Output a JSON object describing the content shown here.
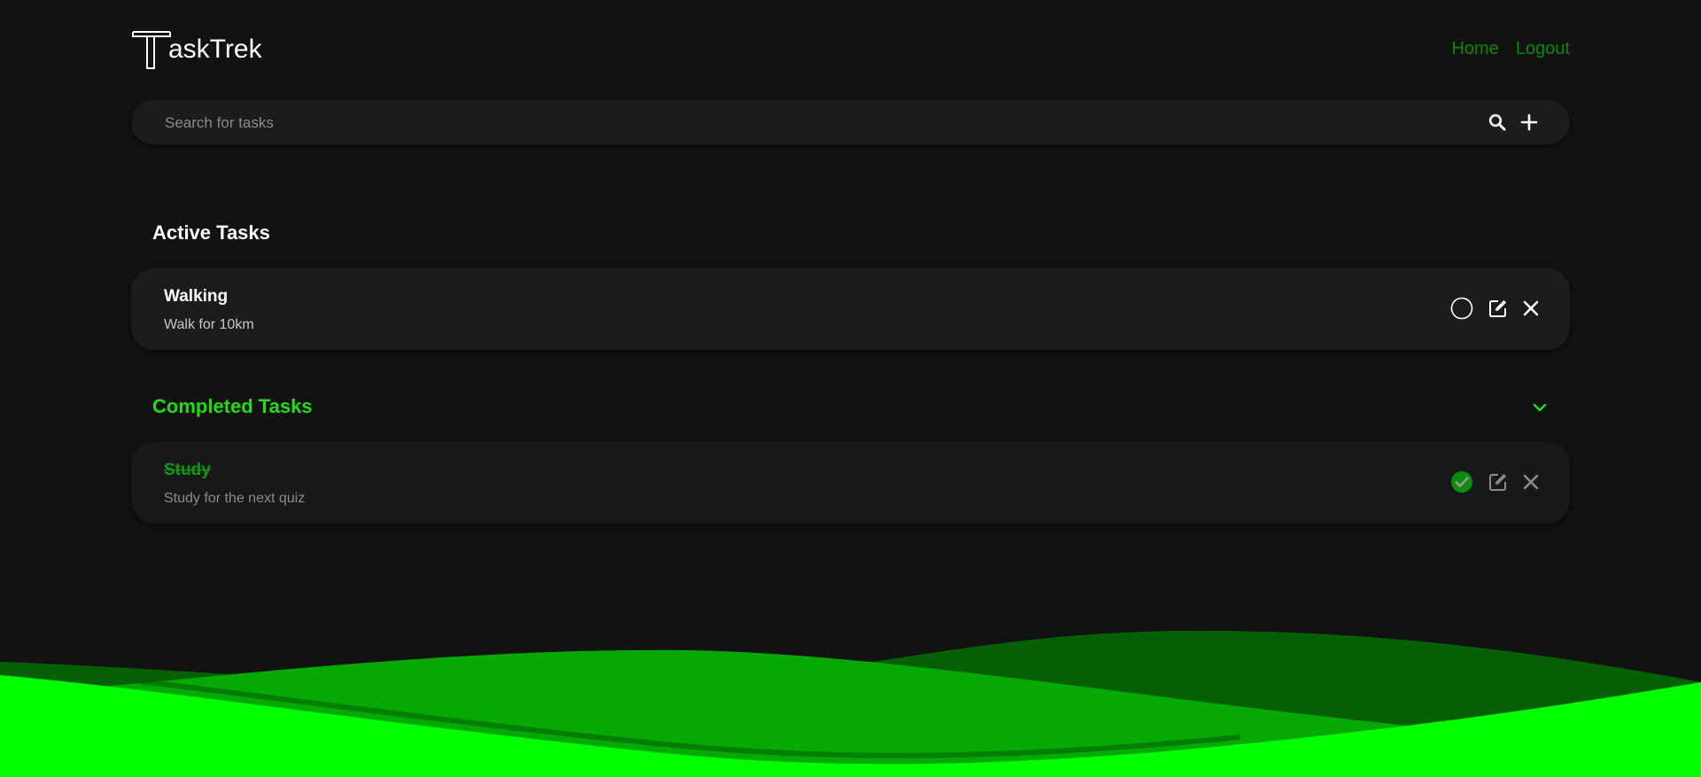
{
  "app": {
    "logo_letter": "T",
    "logo_text": "askTrek"
  },
  "nav": {
    "home_label": "Home",
    "logout_label": "Logout"
  },
  "search": {
    "placeholder": "Search for tasks",
    "value": ""
  },
  "sections": {
    "active_title": "Active Tasks",
    "completed_title": "Completed Tasks"
  },
  "active_tasks": [
    {
      "title": "Walking",
      "description": "Walk for 10km",
      "completed": false
    }
  ],
  "completed_tasks": [
    {
      "title": "Study",
      "description": "Study for the next quiz",
      "completed": true
    }
  ],
  "icons": {
    "search": "search-icon",
    "add": "plus-icon",
    "collapse": "chevron-down-icon",
    "incomplete": "circle-icon",
    "complete": "check-circle-icon",
    "edit": "edit-icon",
    "delete": "close-icon"
  },
  "colors": {
    "background": "#121212",
    "card": "#1c1c1c",
    "accent": "#22dd11",
    "nav_link": "#0a8a0a",
    "completed_title": "#0d9a0d",
    "wave_bright": "#00ff00",
    "wave_mid": "#04a904",
    "wave_dark": "#056005"
  }
}
